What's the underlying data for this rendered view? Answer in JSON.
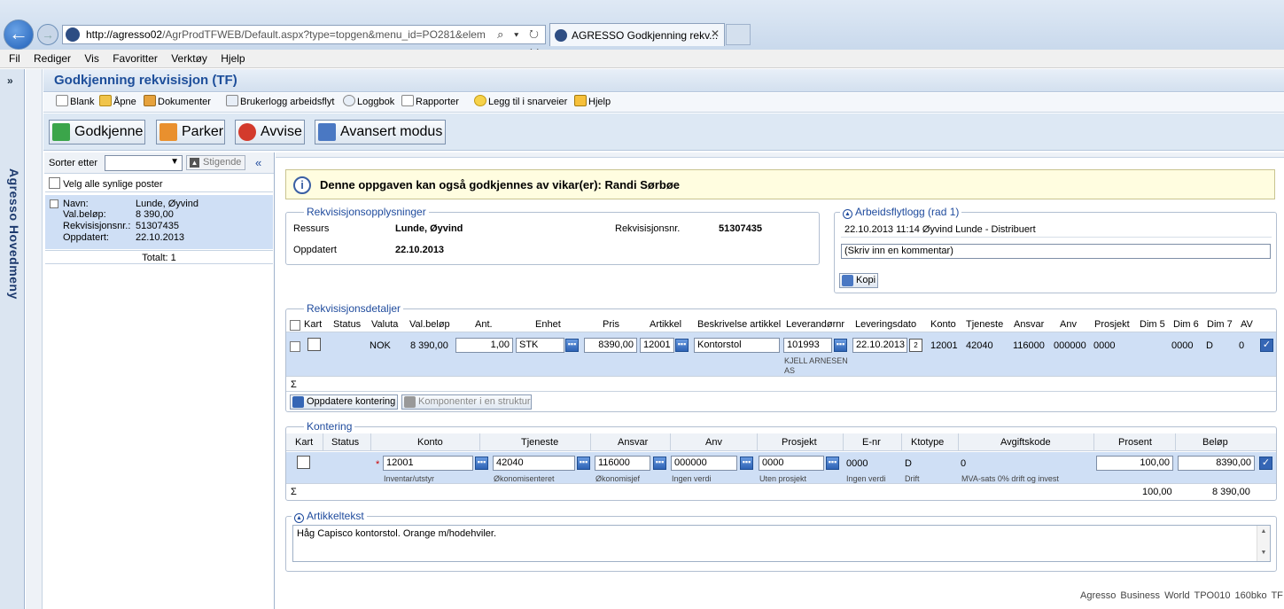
{
  "browser": {
    "url_host": "http://agresso02",
    "url_path": "/AgrProdTFWEB/Default.aspx?type=topgen&menu_id=PO281&elem",
    "tab_title": "AGRESSO Godkjenning rekv...",
    "tab_close": "✕",
    "address_tools": "⌕ ▾ ↻ ✕",
    "menu": [
      "Fil",
      "Rediger",
      "Vis",
      "Favoritter",
      "Verktøy",
      "Hjelp"
    ]
  },
  "side": {
    "expand": "»",
    "title": "Agresso Hovedmeny"
  },
  "app": {
    "title": "Godkjenning rekvisisjon (TF)",
    "toolbar": [
      "Blank",
      "Åpne",
      "Dokumenter",
      "Brukerlogg arbeidsflyt",
      "Loggbok",
      "Rapporter",
      "Legg til i snarveier",
      "Hjelp"
    ],
    "actions": {
      "approve": "Godkjenne",
      "park": "Parker",
      "reject": "Avvise",
      "advanced": "Avansert modus"
    }
  },
  "list": {
    "sort_label": "Sorter etter",
    "sort_value": "",
    "sort_order": "Stigende",
    "collapse": "«",
    "select_all": "Velg alle synlige poster",
    "card": {
      "labels": [
        "Navn:",
        "Val.beløp:",
        "Rekvisisjonsnr.:",
        "Oppdatert:"
      ],
      "values": [
        "Lunde, Øyvind",
        "8 390,00",
        "51307435",
        "22.10.2013"
      ]
    },
    "total": "Totalt: 1"
  },
  "info_banner": "Denne oppgaven kan også godkjennes av vikar(er): Randi Sørbøe",
  "requisition": {
    "legend": "Rekvisisjonsopplysninger",
    "ressurs_label": "Ressurs",
    "ressurs_value": "Lunde, Øyvind",
    "reknr_label": "Rekvisisjonsnr.",
    "reknr_value": "51307435",
    "oppdatert_label": "Oppdatert",
    "oppdatert_value": "22.10.2013"
  },
  "workflow": {
    "legend": "Arbeidsflytlogg (rad 1)",
    "entry": "22.10.2013 11:14 Øyvind Lunde - Distribuert",
    "comment_placeholder": "(Skriv inn en kommentar)",
    "copy": "Kopi"
  },
  "details": {
    "legend": "Rekvisisjonsdetaljer",
    "headers": [
      "Kart",
      "Status",
      "Valuta",
      "Val.beløp",
      "Ant.",
      "Enhet",
      "Pris",
      "Artikkel",
      "Beskrivelse artikkel",
      "Leverandørnr",
      "Leveringsdato",
      "Konto",
      "Tjeneste",
      "Ansvar",
      "Anv",
      "Prosjekt",
      "Dim 5",
      "Dim 6",
      "Dim 7",
      "AV"
    ],
    "row": {
      "valuta": "NOK",
      "valbelop": "8 390,00",
      "ant": "1,00",
      "enhet": "STK",
      "pris": "8390,00",
      "artikkel": "12001",
      "beskrivelse": "Kontorstol",
      "leverandor": "101993",
      "leverandor_name_1": "KJELL ARNESEN",
      "leverandor_name_2": "AS",
      "leveringsdato": "22.10.2013",
      "konto": "12001",
      "tjeneste": "42040",
      "ansvar": "116000",
      "anv": "000000",
      "prosjekt": "0000",
      "dim6": "0000",
      "dim7": "D",
      "av": "0"
    },
    "sigma": "Σ",
    "btn_update": "Oppdatere kontering",
    "btn_components": "Komponenter i en struktur"
  },
  "kontering": {
    "legend": "Kontering",
    "headers": [
      "Kart",
      "Status",
      "Konto",
      "Tjeneste",
      "Ansvar",
      "Anv",
      "Prosjekt",
      "E-nr",
      "Ktotype",
      "Avgiftskode",
      "Prosent",
      "Beløp"
    ],
    "row": {
      "required": "*",
      "konto": "12001",
      "konto_desc": "Inventar/utstyr",
      "tjeneste": "42040",
      "tjeneste_desc": "Økonomisenteret",
      "ansvar": "116000",
      "ansvar_desc": "Økonomisjef",
      "anv": "000000",
      "anv_desc": "Ingen verdi",
      "prosjekt": "0000",
      "prosjekt_desc": "Uten prosjekt",
      "enr": "0000",
      "enr_desc": "Ingen verdi",
      "ktotype": "D",
      "ktotype_desc": "Drift",
      "avgiftskode": "0",
      "avgift_desc": "MVA-sats 0% drift og invest",
      "prosent": "100,00",
      "belop": "8390,00"
    },
    "sigma": "Σ",
    "sum_prosent": "100,00",
    "sum_belop": "8 390,00"
  },
  "artikkeltekst": {
    "legend": "Artikkeltekst",
    "text": "Håg Capisco kontorstol. Orange m/hodehviler."
  },
  "footer": "Agresso Business World  TPO010  160bko  TF",
  "colors": {
    "accent": "#1f4b9d",
    "selected_row": "#cfdff5",
    "banner": "#fffde0"
  }
}
